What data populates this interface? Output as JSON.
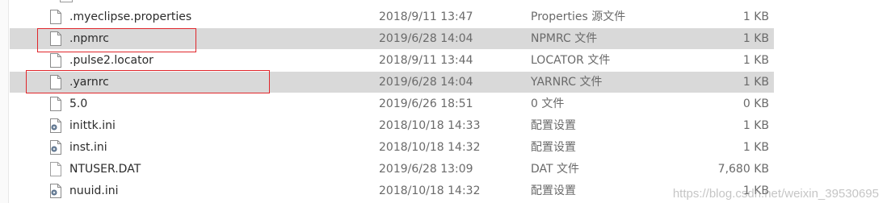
{
  "files": [
    {
      "name": ".myeclipse.properties",
      "date": "2018/9/11 13:47",
      "type": "Properties 源文件",
      "size": "1 KB",
      "icon": "document-icon",
      "selected": false
    },
    {
      "name": ".npmrc",
      "date": "2019/6/28 14:04",
      "type": "NPMRC 文件",
      "size": "1 KB",
      "icon": "document-icon",
      "selected": true
    },
    {
      "name": ".pulse2.locator",
      "date": "2018/9/11 13:44",
      "type": "LOCATOR 文件",
      "size": "1 KB",
      "icon": "document-icon",
      "selected": false
    },
    {
      "name": ".yarnrc",
      "date": "2019/6/28 14:04",
      "type": "YARNRC 文件",
      "size": "1 KB",
      "icon": "document-icon",
      "selected": true
    },
    {
      "name": "5.0",
      "date": "2019/6/26 18:51",
      "type": "0 文件",
      "size": "0 KB",
      "icon": "document-icon",
      "selected": false
    },
    {
      "name": "inittk.ini",
      "date": "2018/10/18 14:33",
      "type": "配置设置",
      "size": "1 KB",
      "icon": "settings-file-icon",
      "selected": false
    },
    {
      "name": "inst.ini",
      "date": "2018/10/18 14:32",
      "type": "配置设置",
      "size": "1 KB",
      "icon": "settings-file-icon",
      "selected": false
    },
    {
      "name": "NTUSER.DAT",
      "date": "2019/6/28 13:09",
      "type": "DAT 文件",
      "size": "7,680 KB",
      "icon": "blank-file-icon",
      "selected": false
    },
    {
      "name": "nuuid.ini",
      "date": "2018/10/18 14:32",
      "type": "配置设置",
      "size": "1 KB",
      "icon": "settings-file-icon",
      "selected": false
    }
  ],
  "watermark": "https://blog.csdn.net/weixin_39530695",
  "colors": {
    "selected_row": "#d9d9d9",
    "annotation_box": "#e0262b",
    "secondary_text": "#6a6a6a"
  }
}
